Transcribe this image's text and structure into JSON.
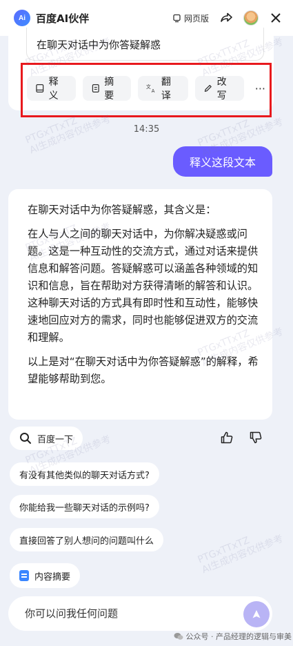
{
  "header": {
    "logo_text": "Ai",
    "title": "百度AI伙伴",
    "web_version_label": "网页版"
  },
  "context": {
    "quoted_text": "在聊天对话中为你答疑解惑"
  },
  "tools": [
    {
      "label": "释义",
      "icon": "book-icon"
    },
    {
      "label": "摘要",
      "icon": "document-icon"
    },
    {
      "label": "翻译",
      "icon": "translate-icon"
    },
    {
      "label": "改写",
      "icon": "pen-icon"
    }
  ],
  "tools_more_label": "···",
  "timestamp": "14:35",
  "user_message": "释义这段文本",
  "answer": {
    "paragraphs": [
      "在聊天对话中为你答疑解惑，其含义是：",
      "在人与人之间的聊天对话中，为你解决疑惑或问题。这是一种互动性的交流方式，通过对话来提供信息和解答问题。答疑解惑可以涵盖各种领域的知识和信息，旨在帮助对方获得清晰的解答和认识。这种聊天对话的方式具有即时性和互动性，能够快速地回应对方的需求，同时也能够促进双方的交流和理解。",
      "以上是对“在聊天对话中为你答疑解惑”的解释，希望能够帮助到您。"
    ]
  },
  "actions": {
    "search_label": "百度一下"
  },
  "suggestions": [
    "有没有其他类似的聊天对话方式?",
    "你能给我一些聊天对话的示例吗?",
    "直接回答了别人想问的问题叫什么"
  ],
  "summary_chip_label": "内容摘要",
  "input": {
    "placeholder": "你可以问我任何问题"
  },
  "footer_watermark": "公众号 · 产品经理的逻辑与审美",
  "watermark_lines": [
    "PTGxTTxTZ",
    "AI生成内容仅供参考"
  ],
  "colors": {
    "accent": "#6a5cff",
    "highlight_border": "#e8191d",
    "background": "#eef1f8"
  }
}
